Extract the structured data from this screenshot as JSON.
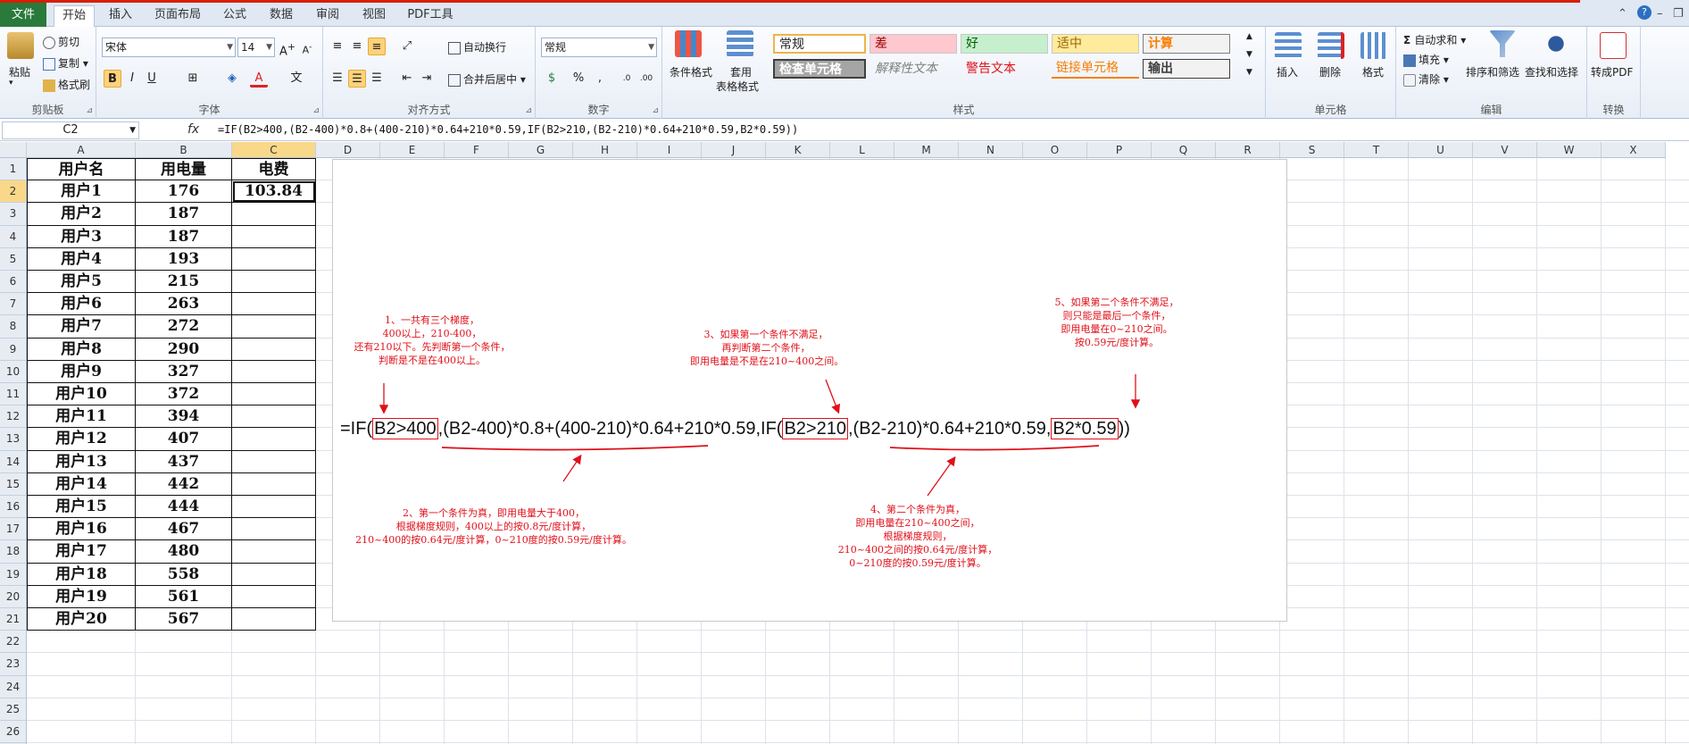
{
  "tabs": [
    "文件",
    "开始",
    "插入",
    "页面布局",
    "公式",
    "数据",
    "审阅",
    "视图",
    "PDF工具"
  ],
  "active_tab": "开始",
  "ribbon": {
    "clipboard": {
      "paste": "粘贴",
      "cut": "剪切",
      "copy": "复制",
      "format_painter": "格式刷",
      "label": "剪贴板"
    },
    "font": {
      "name": "宋体",
      "size": "14",
      "label": "字体"
    },
    "alignment": {
      "wrap": "自动换行",
      "merge": "合并后居中",
      "label": "对齐方式"
    },
    "number": {
      "format": "常规",
      "label": "数字"
    },
    "styles": {
      "conditional": "条件格式",
      "table_format_1": "套用",
      "table_format_2": "表格格式",
      "cells": [
        "常规",
        "差",
        "好",
        "适中",
        "计算",
        "检查单元格",
        "解释性文本",
        "警告文本",
        "链接单元格",
        "输出"
      ],
      "label": "样式"
    },
    "cells": {
      "insert": "插入",
      "delete": "删除",
      "format": "格式",
      "label": "单元格"
    },
    "editing": {
      "autosum": "自动求和",
      "fill": "填充",
      "clear": "清除",
      "sort": "排序和筛选",
      "find": "查找和选择",
      "label": "编辑"
    },
    "convert": {
      "pdf": "转成PDF",
      "label": "转换"
    }
  },
  "formula_bar": {
    "name_box": "C2",
    "fx": "fx",
    "formula": "=IF(B2>400,(B2-400)*0.8+(400-210)*0.64+210*0.59,IF(B2>210,(B2-210)*0.64+210*0.59,B2*0.59))"
  },
  "columns": [
    "A",
    "B",
    "C",
    "D",
    "E",
    "F",
    "G",
    "H",
    "I",
    "J",
    "K",
    "L",
    "M",
    "N",
    "O",
    "P",
    "Q",
    "R",
    "S",
    "T",
    "U",
    "V",
    "W",
    "X"
  ],
  "rows": [
    "1",
    "2",
    "3",
    "4",
    "5",
    "6",
    "7",
    "8",
    "9",
    "10",
    "11",
    "12",
    "13",
    "14",
    "15",
    "16",
    "17",
    "18",
    "19",
    "20",
    "21",
    "22",
    "23",
    "24",
    "25",
    "26",
    "27"
  ],
  "table": {
    "headers": [
      "用户名",
      "用电量",
      "电费"
    ],
    "users": [
      "用户1",
      "用户2",
      "用户3",
      "用户4",
      "用户5",
      "用户6",
      "用户7",
      "用户8",
      "用户9",
      "用户10",
      "用户11",
      "用户12",
      "用户13",
      "用户14",
      "用户15",
      "用户16",
      "用户17",
      "用户18",
      "用户19",
      "用户20"
    ],
    "usage": [
      "176",
      "187",
      "187",
      "193",
      "215",
      "263",
      "272",
      "290",
      "327",
      "372",
      "394",
      "407",
      "437",
      "442",
      "444",
      "467",
      "480",
      "558",
      "561",
      "567"
    ],
    "fee_c2": "103.84"
  },
  "annotation": {
    "note1": [
      "1、一共有三个梯度，",
      "400以上，210-400，",
      "还有210以下。先判断第一个条件，",
      "判断是不是在400以上。"
    ],
    "note2": [
      "2、第一个条件为真，即用电量大于400，",
      "根据梯度规则，400以上的按0.8元/度计算，",
      "210~400的按0.64元/度计算，0~210度的按0.59元/度计算。"
    ],
    "note3": [
      "3、如果第一个条件不满足，",
      "再判断第二个条件，",
      "即用电量是不是在210~400之间。"
    ],
    "note4": [
      "4、第二个条件为真，",
      "即用电量在210~400之间，",
      "根据梯度规则，",
      "210~400之间的按0.64元/度计算，",
      "0~210度的按0.59元/度计算。"
    ],
    "note5": [
      "5、如果第二个条件不满足，",
      "则只能是最后一个条件，",
      "即用电量在0~210之间。",
      "按0.59元/度计算。"
    ],
    "formula_parts": [
      "=IF(",
      "B2>400",
      ",",
      "(B2-400)*0.8+(400-210)*0.64+210*0.59",
      ",IF(",
      "B2>210",
      ",",
      "(B2-210)*0.64+210*0.59",
      ",",
      "B2*0.59",
      "))"
    ]
  },
  "colors": {
    "accent_red": "#e0101a",
    "file_tab": "#2a7a3b",
    "selection": "#f9d88a"
  }
}
